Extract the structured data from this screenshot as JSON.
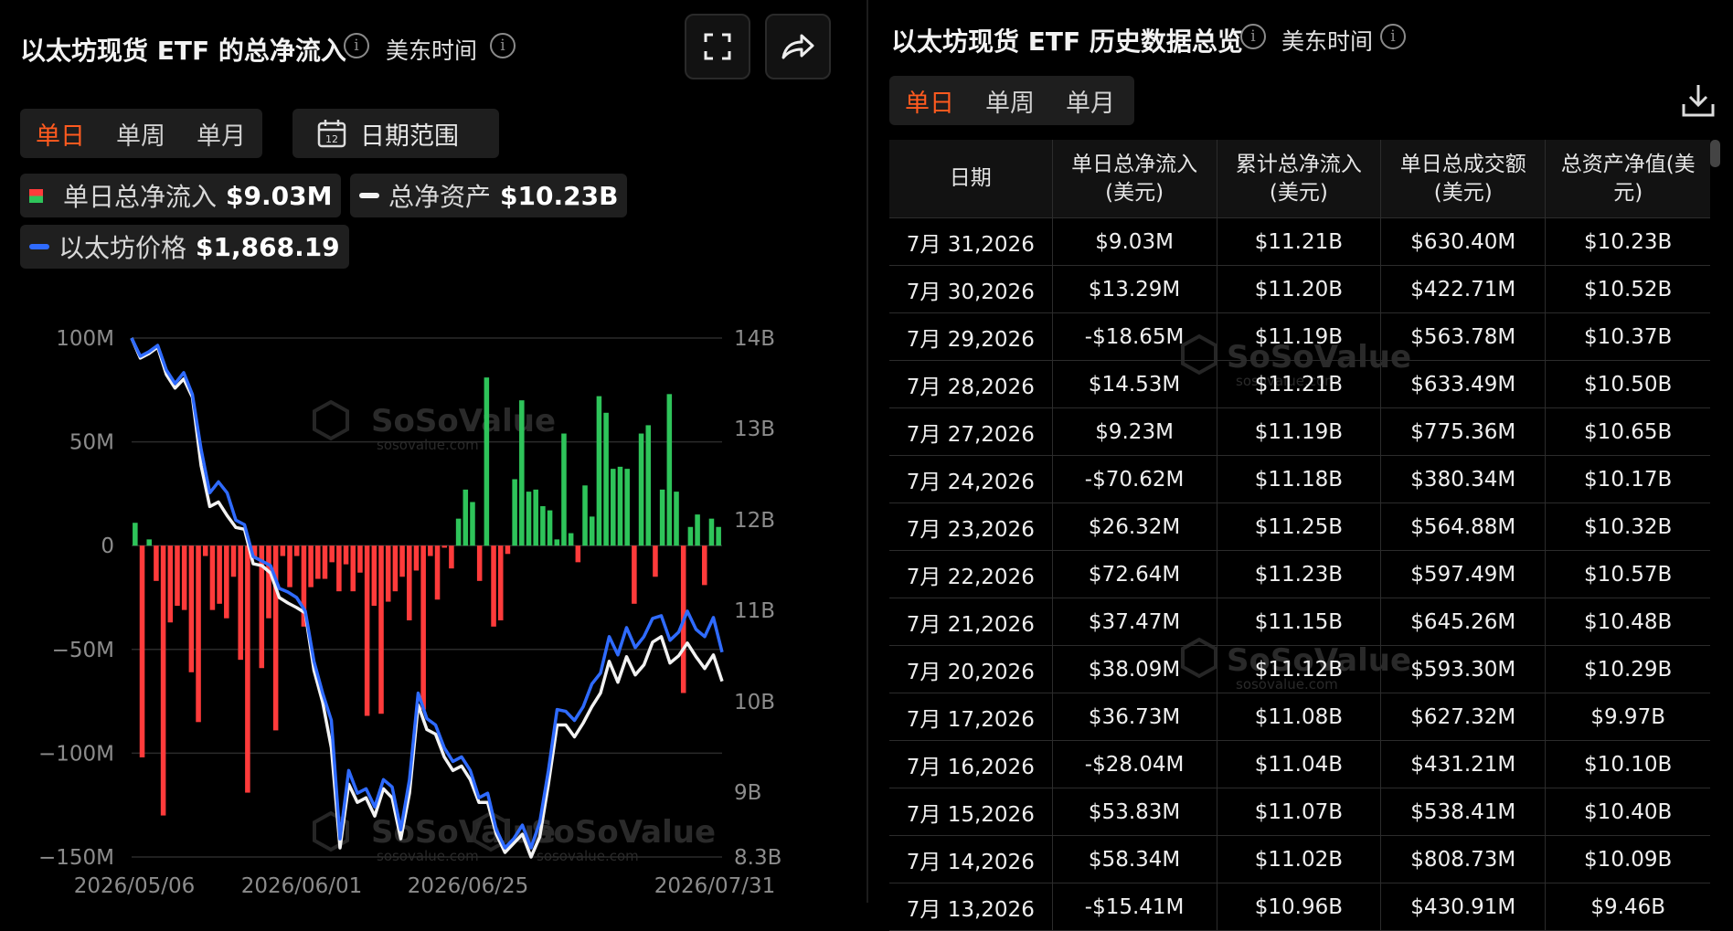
{
  "left": {
    "title": "以太坊现货 ETF 的总净流入",
    "timezone": "美东时间",
    "tabs": [
      "单日",
      "单周",
      "单月"
    ],
    "date_range": "日期范围",
    "calendar_day": "12",
    "legend": [
      {
        "label": "单日总净流入",
        "value": "$9.03M"
      },
      {
        "label": "总净资产",
        "value": "$10.23B"
      },
      {
        "label": "以太坊价格",
        "value": "$1,868.19"
      }
    ],
    "watermark": "SoSoValue",
    "watermark_url": "sosovalue.com"
  },
  "right": {
    "title": "以太坊现货 ETF 历史数据总览",
    "timezone": "美东时间",
    "tabs": [
      "单日",
      "单周",
      "单月"
    ],
    "watermark": "SoSoValue",
    "watermark_url": "sosovalue.com",
    "table": {
      "headers": [
        "日期",
        "单日总净流入\n(美元)",
        "累计总净流入\n(美元)",
        "单日总成交额\n(美元)",
        "总资产净值(美\n元)"
      ],
      "rows": [
        [
          "7月 31,2026",
          "$9.03M",
          "$11.21B",
          "$630.40M",
          "$10.23B"
        ],
        [
          "7月 30,2026",
          "$13.29M",
          "$11.20B",
          "$422.71M",
          "$10.52B"
        ],
        [
          "7月 29,2026",
          "-$18.65M",
          "$11.19B",
          "$563.78M",
          "$10.37B"
        ],
        [
          "7月 28,2026",
          "$14.53M",
          "$11.21B",
          "$633.49M",
          "$10.50B"
        ],
        [
          "7月 27,2026",
          "$9.23M",
          "$11.19B",
          "$775.36M",
          "$10.65B"
        ],
        [
          "7月 24,2026",
          "-$70.62M",
          "$11.18B",
          "$380.34M",
          "$10.17B"
        ],
        [
          "7月 23,2026",
          "$26.32M",
          "$11.25B",
          "$564.88M",
          "$10.32B"
        ],
        [
          "7月 22,2026",
          "$72.64M",
          "$11.23B",
          "$597.49M",
          "$10.57B"
        ],
        [
          "7月 21,2026",
          "$37.47M",
          "$11.15B",
          "$645.26M",
          "$10.48B"
        ],
        [
          "7月 20,2026",
          "$38.09M",
          "$11.12B",
          "$593.30M",
          "$10.29B"
        ],
        [
          "7月 17,2026",
          "$36.73M",
          "$11.08B",
          "$627.32M",
          "$9.97B"
        ],
        [
          "7月 16,2026",
          "-$28.04M",
          "$11.04B",
          "$431.21M",
          "$10.10B"
        ],
        [
          "7月 15,2026",
          "$53.83M",
          "$11.07B",
          "$538.41M",
          "$10.40B"
        ],
        [
          "7月 14,2026",
          "$58.34M",
          "$11.02B",
          "$808.73M",
          "$10.09B"
        ],
        [
          "7月 13,2026",
          "-$15.41M",
          "$10.96B",
          "$430.91M",
          "$9.46B"
        ]
      ]
    }
  },
  "chart_data": {
    "type": "bar",
    "title": "以太坊现货 ETF 的总净流入",
    "x_tick_labels": [
      "2026/05/06",
      "2026/06/01",
      "2026/06/25",
      "2026/07/31"
    ],
    "left_axis": {
      "ticks": [
        "100M",
        "50M",
        "0",
        "−50M",
        "−100M",
        "−150M"
      ],
      "range": [
        -150,
        100
      ],
      "unit": "M USD"
    },
    "right_axis": {
      "ticks": [
        "14B",
        "13B",
        "12B",
        "11B",
        "10B",
        "9B",
        "8.3B"
      ],
      "range": [
        8.3,
        14
      ],
      "unit": "B USD"
    },
    "series": [
      {
        "name": "单日总净流入",
        "type": "bar",
        "axis": "left",
        "color_pos": "#2ec45a",
        "color_neg": "#ff3b3b",
        "values": [
          11,
          -102,
          3,
          -17,
          -130,
          -37,
          -29,
          -31,
          -61,
          -85,
          -5,
          -31,
          -28,
          -35,
          -15,
          -55,
          -119,
          -6,
          -59,
          -35,
          -89,
          -5,
          -20,
          -5,
          -39,
          -20,
          -16,
          -16,
          -8,
          -22,
          -9,
          -22,
          -13,
          -82,
          -29,
          -81,
          -27,
          -22,
          -15,
          -36,
          -12,
          -79,
          -5,
          -26,
          -1,
          -11,
          13,
          27,
          21,
          -17,
          81,
          -39,
          -36,
          -4,
          32,
          70,
          26,
          27,
          19,
          17,
          3,
          54,
          6,
          -8,
          29,
          14,
          72,
          64,
          37,
          38,
          37,
          -28,
          54,
          58,
          -15,
          27,
          73,
          26,
          -71,
          9,
          15,
          -19,
          13,
          9
        ]
      },
      {
        "name": "总净资产",
        "type": "line",
        "axis": "right",
        "color": "#f2f2f2",
        "values": [
          14.0,
          13.78,
          13.83,
          13.9,
          13.6,
          13.45,
          13.55,
          13.35,
          12.6,
          12.15,
          12.2,
          12.05,
          11.92,
          11.9,
          11.52,
          11.5,
          11.42,
          11.15,
          11.09,
          11.04,
          10.98,
          10.35,
          10.0,
          9.5,
          8.4,
          9.1,
          8.9,
          8.95,
          8.75,
          9.05,
          8.95,
          8.5,
          9.0,
          9.97,
          9.7,
          9.65,
          9.4,
          9.25,
          9.3,
          9.15,
          8.9,
          8.9,
          8.55,
          8.35,
          8.45,
          8.55,
          8.3,
          8.52,
          9.1,
          9.75,
          9.75,
          9.62,
          9.77,
          9.95,
          10.1,
          10.45,
          10.22,
          10.5,
          10.3,
          10.41,
          10.66,
          10.72,
          10.43,
          10.51,
          10.65,
          10.5,
          10.37,
          10.52,
          10.23
        ]
      },
      {
        "name": "以太坊价格",
        "type": "line",
        "axis": "right",
        "color": "#2f6bff",
        "values": [
          14.0,
          13.8,
          13.85,
          13.92,
          13.65,
          13.5,
          13.62,
          13.38,
          12.78,
          12.3,
          12.42,
          12.3,
          12.0,
          11.95,
          11.6,
          11.55,
          11.5,
          11.25,
          11.21,
          11.15,
          11.0,
          10.45,
          10.1,
          9.8,
          8.5,
          9.25,
          9.0,
          9.05,
          8.85,
          9.15,
          9.07,
          8.6,
          9.15,
          10.1,
          9.82,
          9.75,
          9.5,
          9.35,
          9.4,
          9.25,
          8.95,
          9.0,
          8.6,
          8.4,
          8.5,
          8.65,
          8.4,
          8.68,
          9.25,
          9.92,
          9.9,
          9.8,
          9.95,
          10.2,
          10.32,
          10.72,
          10.52,
          10.82,
          10.6,
          10.72,
          10.92,
          10.95,
          10.68,
          10.77,
          11.0,
          10.8,
          10.72,
          10.93,
          10.55
        ]
      }
    ],
    "grid": true,
    "legend_position": "top-left"
  }
}
